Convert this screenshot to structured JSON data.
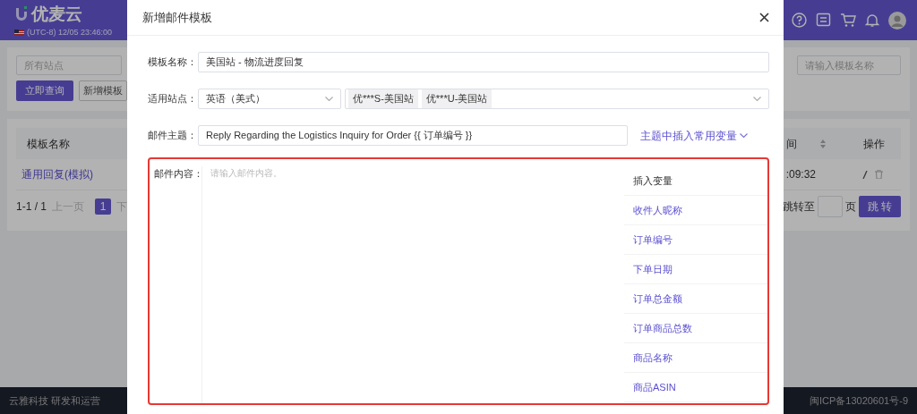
{
  "app": {
    "logo": "优麦云",
    "clock": "(UTC-8) 12/05 23:46:00"
  },
  "filters": {
    "site_placeholder": "所有站点",
    "name_placeholder": "请输入模板名称",
    "buttons": [
      {
        "label": "立即查询",
        "kind": "primary"
      },
      {
        "label": "新增模板",
        "kind": "outline"
      }
    ]
  },
  "table": {
    "columns": [
      "模板名称",
      "间",
      "操作"
    ],
    "rows": [
      {
        "name": "通用回复(模拟)",
        "time": ":09:32"
      }
    ]
  },
  "pagination": {
    "range": "1-1 / 1",
    "prev": "上一页",
    "pages": [
      {
        "label": "1",
        "selected": true
      }
    ],
    "next": "下",
    "jump_label": "跳转至",
    "page_unit": "页",
    "jump_button": "跳 转"
  },
  "footer": {
    "left": "云雅科技 研发和运营",
    "right": "闽ICP备13020601号-9"
  },
  "dialog": {
    "title": "新增邮件模板",
    "fields": [
      {
        "kind": "text",
        "label": "模板名称：",
        "value": "美国站 - 物流进度回复"
      },
      {
        "kind": "sites",
        "label": "适用站点：",
        "language": "英语（美式）",
        "tags": [
          "优***S-美国站",
          "优***U-美国站"
        ]
      },
      {
        "kind": "subject",
        "label": "邮件主题：",
        "value": "Reply Regarding the Logistics Inquiry for Order {{ 订单编号 }}",
        "link": "主题中插入常用变量"
      }
    ],
    "content": {
      "label": "邮件内容：",
      "placeholder": "请输入邮件内容。",
      "highlighted": true,
      "variables_title": "插入变量",
      "variables": [
        "收件人昵称",
        "订单编号",
        "下单日期",
        "订单总金额",
        "订单商品总数",
        "商品名称",
        "商品ASIN"
      ]
    }
  }
}
